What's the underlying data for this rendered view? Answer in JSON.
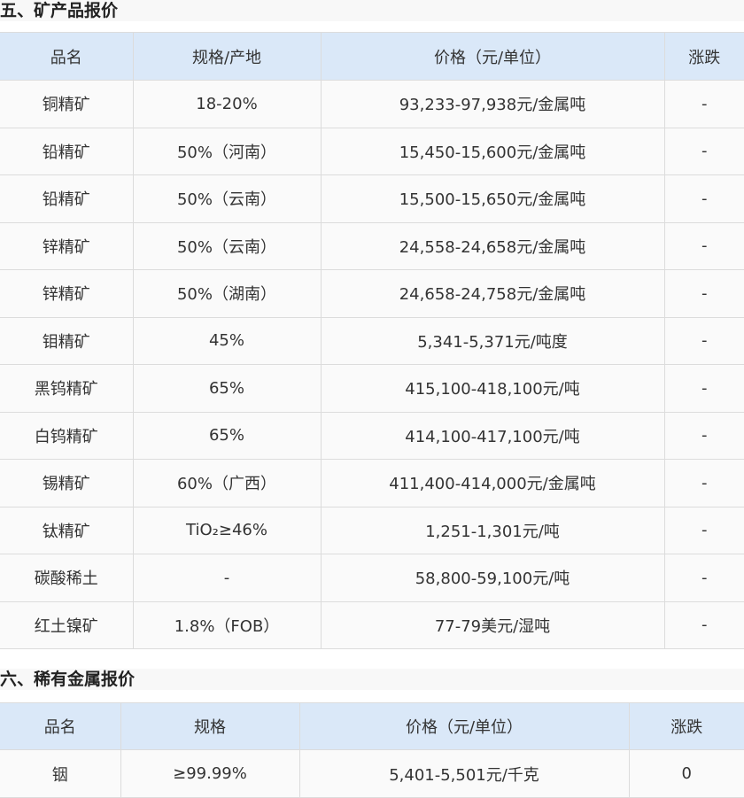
{
  "section5": {
    "title": "五、矿产品报价",
    "headers": [
      "品名",
      "规格/产地",
      "价格（元/单位）",
      "涨跌"
    ],
    "rows": [
      [
        "铜精矿",
        "18-20%",
        "93,233-97,938元/金属吨",
        "-"
      ],
      [
        "铅精矿",
        "50%（河南）",
        "15,450-15,600元/金属吨",
        "-"
      ],
      [
        "铅精矿",
        "50%（云南）",
        "15,500-15,650元/金属吨",
        "-"
      ],
      [
        "锌精矿",
        "50%（云南）",
        "24,558-24,658元/金属吨",
        "-"
      ],
      [
        "锌精矿",
        "50%（湖南）",
        "24,658-24,758元/金属吨",
        "-"
      ],
      [
        "钼精矿",
        "45%",
        "5,341-5,371元/吨度",
        "-"
      ],
      [
        "黑钨精矿",
        "65%",
        "415,100-418,100元/吨",
        "-"
      ],
      [
        "白钨精矿",
        "65%",
        "414,100-417,100元/吨",
        "-"
      ],
      [
        "锡精矿",
        "60%（广西）",
        "411,400-414,000元/金属吨",
        "-"
      ],
      [
        "钛精矿",
        "TiO₂≥46%",
        "1,251-1,301元/吨",
        "-"
      ],
      [
        "碳酸稀土",
        "-",
        "58,800-59,100元/吨",
        "-"
      ],
      [
        "红土镍矿",
        "1.8%（FOB）",
        "77-79美元/湿吨",
        "-"
      ]
    ]
  },
  "section6": {
    "title": "六、稀有金属报价",
    "headers": [
      "品名",
      "规格",
      "价格（元/单位）",
      "涨跌"
    ],
    "rows": [
      [
        "铟",
        "≥99.99%",
        "5,401-5,501元/千克",
        "0"
      ]
    ]
  }
}
